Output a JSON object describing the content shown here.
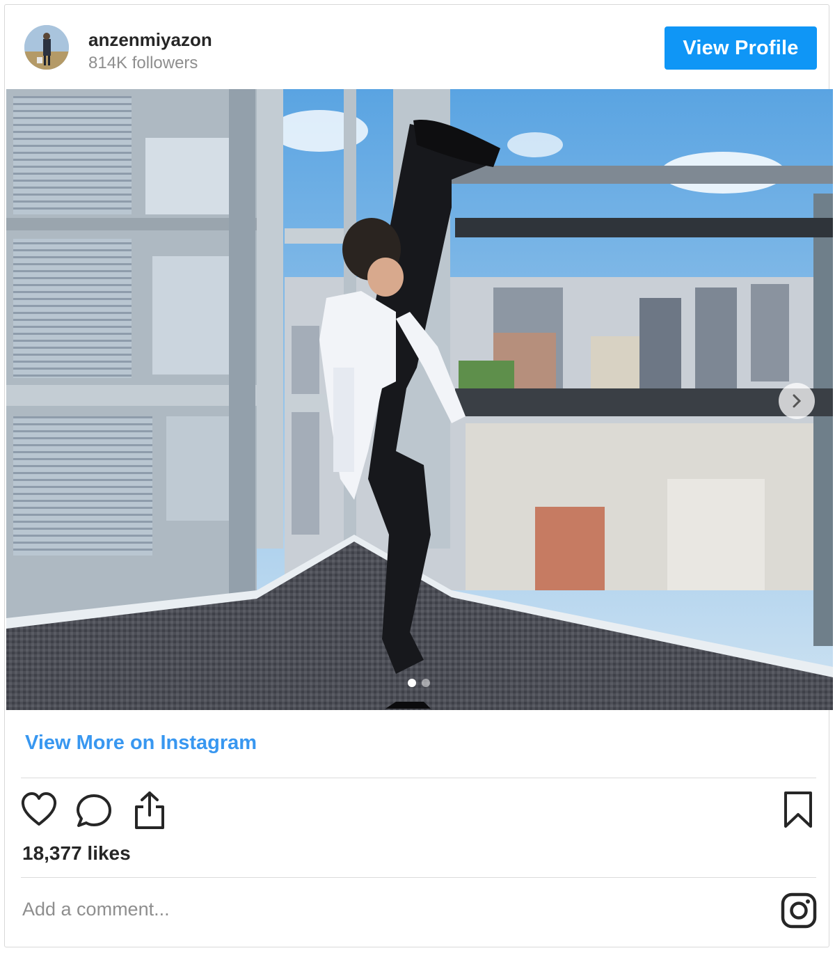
{
  "account": {
    "username": "anzenmiyazon",
    "followers": "814K followers"
  },
  "header": {
    "view_profile_label": "View Profile"
  },
  "post": {
    "carousel_count": 2,
    "carousel_active": 1,
    "view_more_label": "View More on Instagram",
    "likes": "18,377 likes",
    "comment_placeholder": "Add a comment..."
  },
  "icons": {
    "like": "heart-icon",
    "comment": "comment-icon",
    "share": "share-icon",
    "save": "bookmark-icon",
    "brand": "instagram-logo-icon",
    "next": "chevron-right-icon"
  },
  "colors": {
    "primary_button": "#0f96f6",
    "link": "#3897f0",
    "text": "#262626",
    "muted": "#8e8e8e"
  }
}
